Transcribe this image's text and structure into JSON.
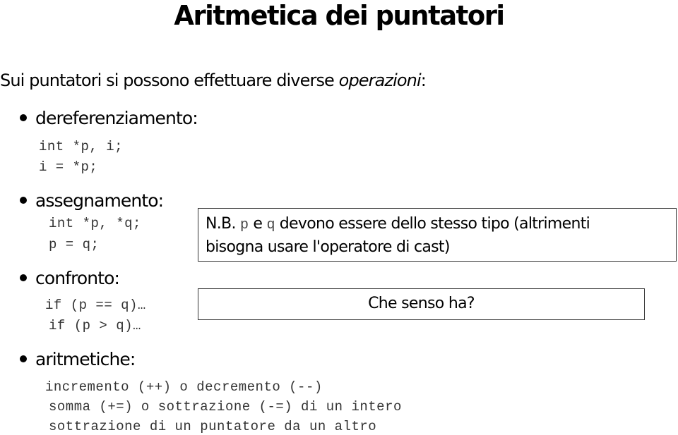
{
  "slide": {
    "title": "Aritmetica dei puntatori",
    "intro": {
      "text": "Sui puntatori si possono effettuare diverse ",
      "emphasis": "operazioni",
      "suffix": ":"
    },
    "sections": [
      {
        "heading": "dereferenziamento:",
        "code": [
          "int *p, i;",
          "i = *p;"
        ]
      },
      {
        "heading": "assegnamento:",
        "code": [
          "int *p, *q;",
          "p = q;"
        ]
      },
      {
        "heading": "confronto:",
        "code": [
          "if (p == q)…",
          "if (p > q)…"
        ]
      },
      {
        "heading": "aritmetiche:",
        "code": [
          "incremento (++) o decremento (--)",
          "somma (+=) o sottrazione (-=) di un intero",
          "sottrazione di un puntatore da un altro"
        ]
      }
    ],
    "note_box": {
      "prefix": "N.B. ",
      "var1": "p",
      "conj": " e ",
      "var2": "q",
      "line1_rest": " devono essere dello stesso tipo (altrimenti",
      "line2": "bisogna usare l'operatore di cast)"
    },
    "question_box": {
      "text": "Che senso ha?"
    }
  }
}
